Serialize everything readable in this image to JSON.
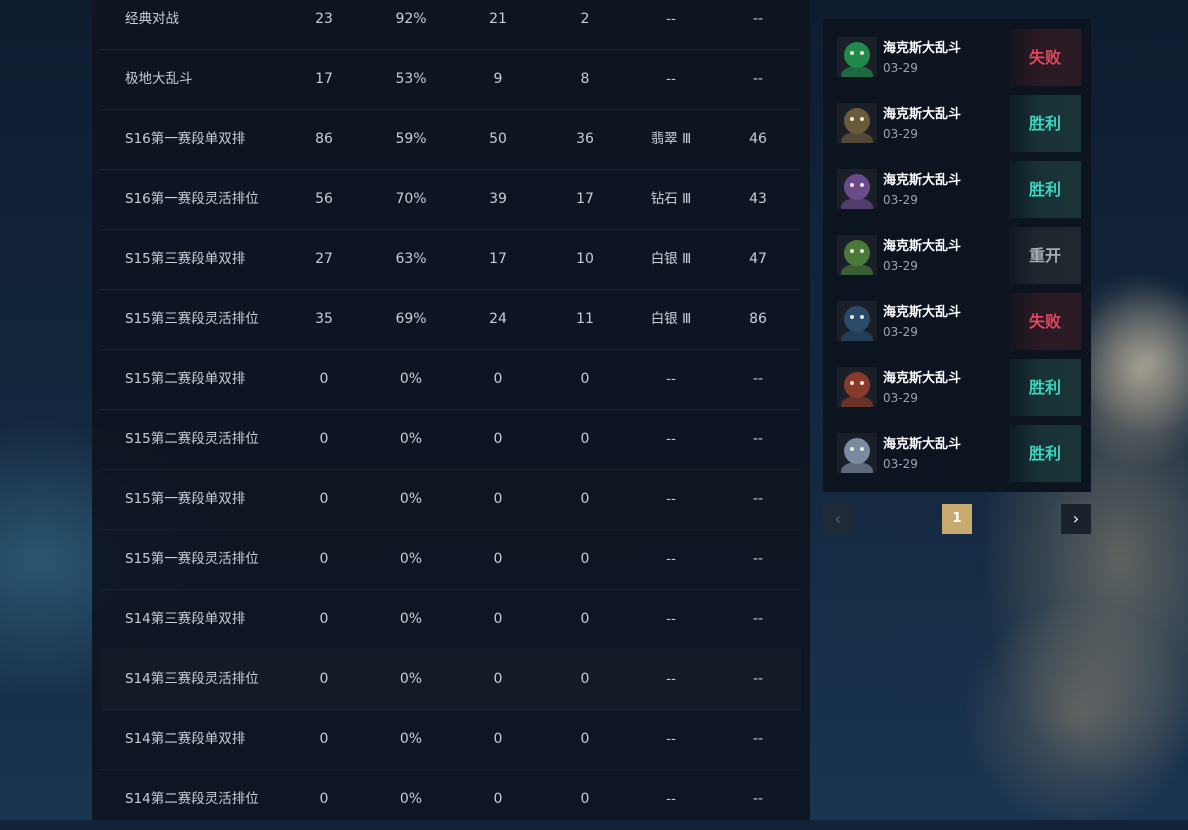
{
  "stats_table": {
    "rows": [
      {
        "name": "经典对战",
        "games": "23",
        "winrate": "92%",
        "wins": "21",
        "losses": "2",
        "rank": "--",
        "lp": "--"
      },
      {
        "name": "极地大乱斗",
        "games": "17",
        "winrate": "53%",
        "wins": "9",
        "losses": "8",
        "rank": "--",
        "lp": "--"
      },
      {
        "name": "S16第一赛段单双排",
        "games": "86",
        "winrate": "59%",
        "wins": "50",
        "losses": "36",
        "rank": "翡翠 Ⅲ",
        "lp": "46"
      },
      {
        "name": "S16第一赛段灵活排位",
        "games": "56",
        "winrate": "70%",
        "wins": "39",
        "losses": "17",
        "rank": "钻石 Ⅲ",
        "lp": "43"
      },
      {
        "name": "S15第三赛段单双排",
        "games": "27",
        "winrate": "63%",
        "wins": "17",
        "losses": "10",
        "rank": "白银 Ⅲ",
        "lp": "47"
      },
      {
        "name": "S15第三赛段灵活排位",
        "games": "35",
        "winrate": "69%",
        "wins": "24",
        "losses": "11",
        "rank": "白银 Ⅲ",
        "lp": "86"
      },
      {
        "name": "S15第二赛段单双排",
        "games": "0",
        "winrate": "0%",
        "wins": "0",
        "losses": "0",
        "rank": "--",
        "lp": "--"
      },
      {
        "name": "S15第二赛段灵活排位",
        "games": "0",
        "winrate": "0%",
        "wins": "0",
        "losses": "0",
        "rank": "--",
        "lp": "--"
      },
      {
        "name": "S15第一赛段单双排",
        "games": "0",
        "winrate": "0%",
        "wins": "0",
        "losses": "0",
        "rank": "--",
        "lp": "--"
      },
      {
        "name": "S15第一赛段灵活排位",
        "games": "0",
        "winrate": "0%",
        "wins": "0",
        "losses": "0",
        "rank": "--",
        "lp": "--"
      },
      {
        "name": "S14第三赛段单双排",
        "games": "0",
        "winrate": "0%",
        "wins": "0",
        "losses": "0",
        "rank": "--",
        "lp": "--"
      },
      {
        "name": "S14第三赛段灵活排位",
        "games": "0",
        "winrate": "0%",
        "wins": "0",
        "losses": "0",
        "rank": "--",
        "lp": "--"
      },
      {
        "name": "S14第二赛段单双排",
        "games": "0",
        "winrate": "0%",
        "wins": "0",
        "losses": "0",
        "rank": "--",
        "lp": "--"
      },
      {
        "name": "S14第二赛段灵活排位",
        "games": "0",
        "winrate": "0%",
        "wins": "0",
        "losses": "0",
        "rank": "--",
        "lp": "--"
      }
    ]
  },
  "match_history": {
    "items": [
      {
        "mode": "海克斯大乱斗",
        "date": "03-29",
        "result": "失败",
        "outcome": "lose",
        "avatar_icon": "green-champion-portrait-icon",
        "avatar_color": "#1f8a4a"
      },
      {
        "mode": "海克斯大乱斗",
        "date": "03-29",
        "result": "胜利",
        "outcome": "win",
        "avatar_icon": "frog-champion-portrait-icon",
        "avatar_color": "#6b5a3a"
      },
      {
        "mode": "海克斯大乱斗",
        "date": "03-29",
        "result": "胜利",
        "outcome": "win",
        "avatar_icon": "purple-champion-portrait-icon",
        "avatar_color": "#6a4a8a"
      },
      {
        "mode": "海克斯大乱斗",
        "date": "03-29",
        "result": "重开",
        "outcome": "remake",
        "avatar_icon": "yordle-champion-portrait-icon",
        "avatar_color": "#4a7a3a"
      },
      {
        "mode": "海克斯大乱斗",
        "date": "03-29",
        "result": "失败",
        "outcome": "lose",
        "avatar_icon": "wolf-champion-portrait-icon",
        "avatar_color": "#2a4a6a"
      },
      {
        "mode": "海克斯大乱斗",
        "date": "03-29",
        "result": "胜利",
        "outcome": "win",
        "avatar_icon": "red-champion-portrait-icon",
        "avatar_color": "#8a3a2a"
      },
      {
        "mode": "海克斯大乱斗",
        "date": "03-29",
        "result": "胜利",
        "outcome": "win",
        "avatar_icon": "armored-champion-portrait-icon",
        "avatar_color": "#7a8aa0"
      }
    ]
  },
  "pagination": {
    "prev_icon": "chevron-left-icon",
    "current_page": "1",
    "next_icon": "chevron-right-icon",
    "prev_glyph": "‹",
    "next_glyph": "›"
  },
  "colors": {
    "lose": "#e0475e",
    "win": "#3fd4c0",
    "remake": "#a7adb5",
    "page_active": "#c8aa6e"
  }
}
